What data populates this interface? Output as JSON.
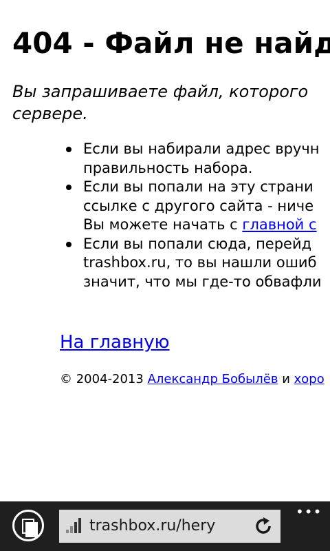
{
  "page": {
    "title": "404 - Файл не найд",
    "lead_lines": [
      "Вы запрашиваете файл, которого",
      "сервере."
    ],
    "tips": [
      {
        "lines": [
          "Если вы набирали адрес вручн",
          "правильность набора."
        ]
      },
      {
        "lines": [
          "Если вы попали на эту страни",
          "ссылке с другого сайта - ниче"
        ],
        "line3_prefix": "Вы можете начать с ",
        "line3_link": "главной с"
      },
      {
        "lines": [
          "Если вы попали сюда, перейд",
          "trashbox.ru, то вы нашли ошиб",
          "значит, что мы где-то обвафли"
        ]
      }
    ],
    "home_link": "На главную",
    "footer": {
      "copyright": "© 2004-2013 ",
      "author_link": "Александр Бобылёв",
      "and": " и ",
      "second_link": "хоро"
    }
  },
  "browser": {
    "address": "trashbox.ru/hery",
    "more_glyph": "•••",
    "colors": {
      "appbar": "#1f1f1f",
      "address_bg": "#dcdcdc",
      "link": "#0000ee"
    }
  }
}
